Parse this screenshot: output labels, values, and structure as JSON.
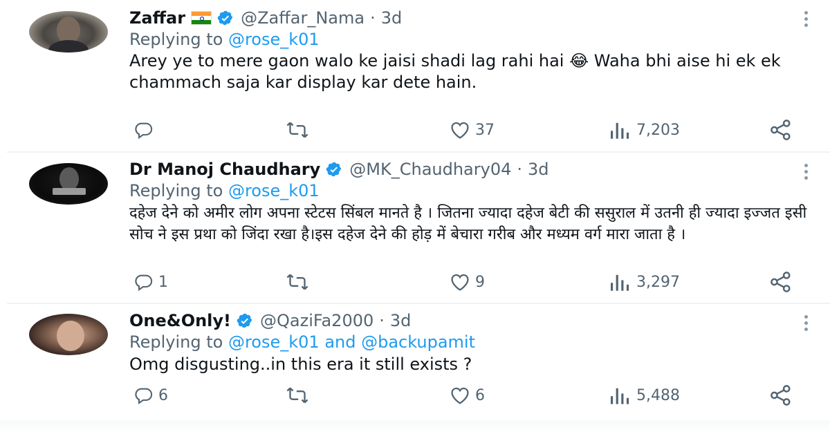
{
  "tweets": [
    {
      "name": "Zaffar",
      "has_flag": true,
      "handle": "@Zaffar_Nama",
      "dot": "·",
      "time": "3d",
      "reply_prefix": "Replying to",
      "reply_mentions": "@rose_k01",
      "body": "Arey ye to mere gaon walo ke jaisi shadi lag rahi hai 😂 Waha bhi aise hi ek ek chammach saja kar display kar dete hain.",
      "replies": "",
      "likes": "37",
      "views": "7,203"
    },
    {
      "name": "Dr Manoj Chaudhary",
      "has_flag": false,
      "handle": "@MK_Chaudhary04",
      "dot": "·",
      "time": "3d",
      "reply_prefix": "Replying to",
      "reply_mentions": "@rose_k01",
      "body": "दहेज देने को अमीर लोग अपना स्टेटस सिंबल मानते है । जितना ज्यादा दहेज बेटी की ससुराल में उतनी ही ज्यादा इज्जत इसी सोच ने इस प्रथा को जिंदा रखा है।इस दहेज देने की होड़ में बेचारा गरीब और मध्यम वर्ग मारा जाता है ।",
      "replies": "1",
      "likes": "9",
      "views": "3,297"
    },
    {
      "name": "One&Only!",
      "has_flag": false,
      "handle": "@QaziFa2000",
      "dot": "·",
      "time": "3d",
      "reply_prefix": "Replying to",
      "reply_mentions": "@rose_k01 and @backupamit",
      "body": "Omg disgusting..in this era it still exists ?",
      "replies": "6",
      "likes": "6",
      "views": "5,488"
    }
  ],
  "icons": {
    "reply": "reply-icon",
    "retweet": "retweet-icon",
    "like": "like-icon",
    "views": "views-icon",
    "share": "share-icon",
    "verified": "verified-badge-icon",
    "more": "more-options-icon"
  },
  "colors": {
    "accent": "#1d9bf0",
    "secondary_text": "#536471",
    "primary_text": "#0f1419",
    "divider": "#eff3f4"
  }
}
